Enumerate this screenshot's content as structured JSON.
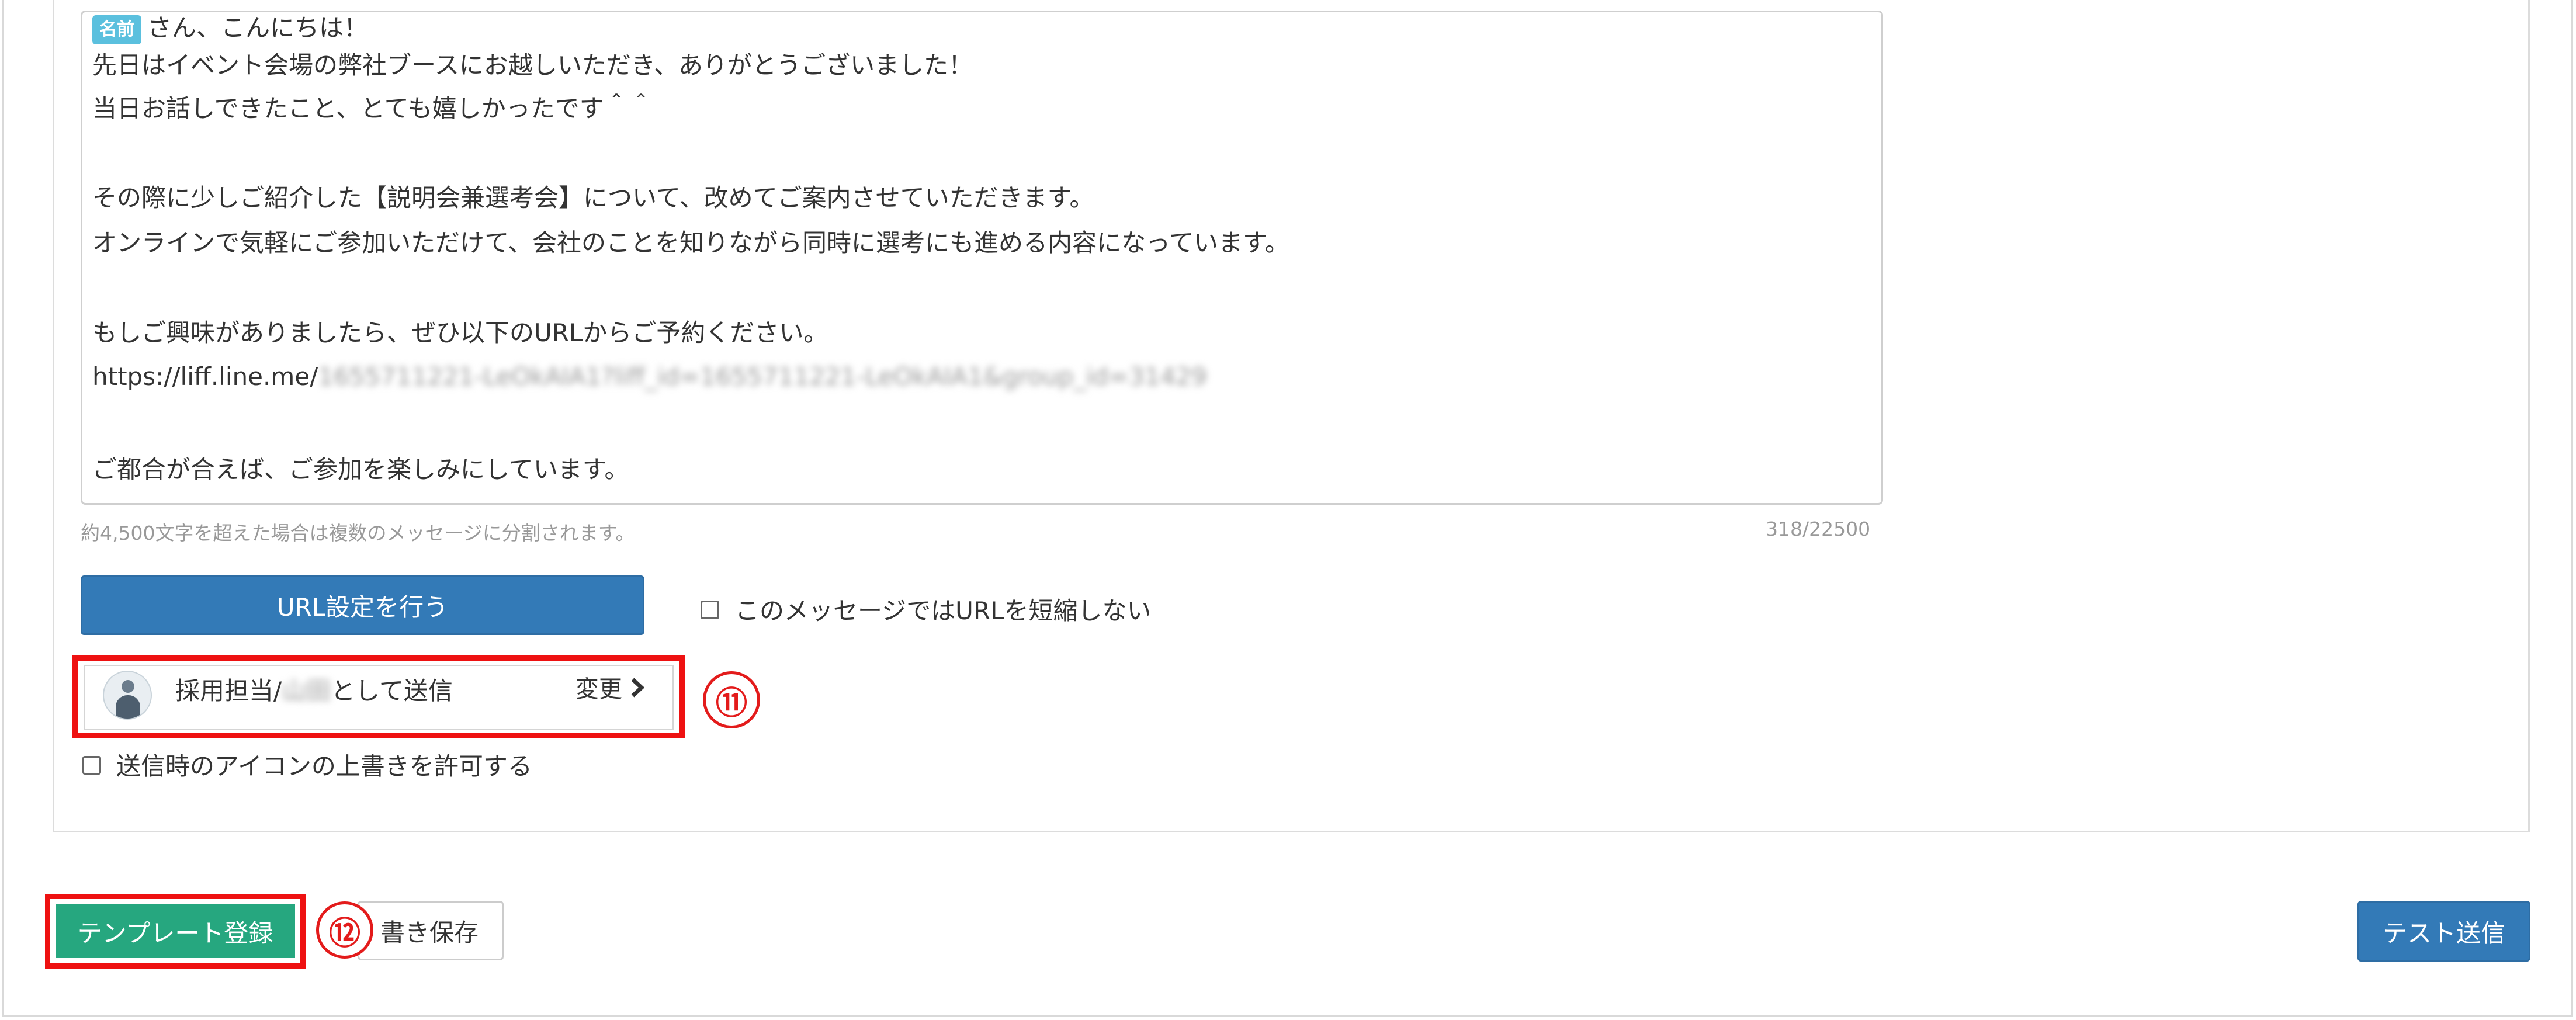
{
  "message": {
    "name_tag": "名前",
    "lines": [
      "さん、こんにちは！",
      "先日はイベント会場の弊社ブースにお越しいただき、ありがとうございました！",
      "当日お話しできたこと、とても嬉しかったです＾＾",
      "その際に少しご紹介した【説明会兼選考会】について、改めてご案内させていただきます。",
      "オンラインで気軽にご参加いただけて、会社のことを知りながら同時に選考にも進める内容になっています。",
      "もしご興味がありましたら、ぜひ以下のURLからご予約ください。",
      "https://liff.line.me/",
      "ご都合が合えば、ご参加を楽しみにしています。"
    ],
    "url_blurred": "1655711221-LeOkAIA1?liff_id=1655711221-LeOkAIA1&group_id=31429",
    "helper_text": "約4,500文字を超えた場合は複数のメッセージに分割されます。",
    "char_count": "318/22500"
  },
  "controls": {
    "url_button_label": "URL設定を行う",
    "no_shorten_label": "このメッセージではURLを短縮しない",
    "override_icon_label": "送信時のアイコンの上書きを許可する"
  },
  "sender": {
    "name_prefix": "採用担当/",
    "name_blurred": "山田",
    "name_suffix": "として送信",
    "change_label": "変更",
    "change_icon": "chevron-right-icon"
  },
  "annotations": {
    "marker_11": "⑪",
    "marker_12": "⑫"
  },
  "footer": {
    "template_button_label": "テンプレート登録",
    "draft_button_label": "書き保存",
    "test_send_label": "テスト送信"
  },
  "colors": {
    "primary_blue": "#337ab7",
    "template_green": "#26a77f",
    "annotation_red": "#ee1111",
    "name_tag": "#5bc0de"
  }
}
